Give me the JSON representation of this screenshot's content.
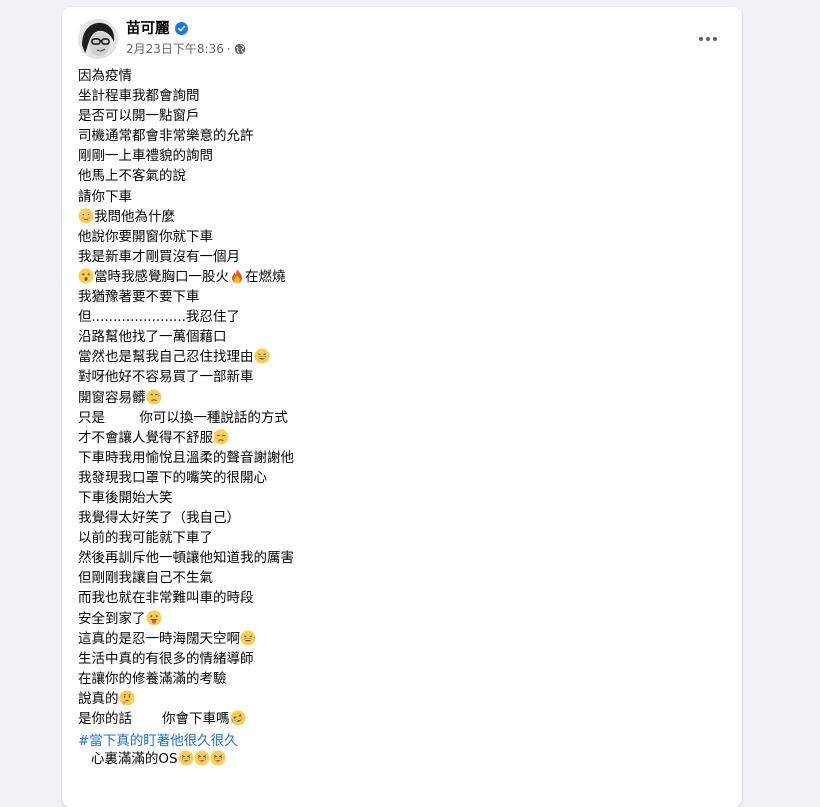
{
  "post": {
    "author": "苗可麗",
    "timestamp": "2月23日下午8:36",
    "meta_separator": "·",
    "lines": [
      {
        "text": "因為疫情"
      },
      {
        "text": "坐計程車我都會詢問"
      },
      {
        "text": "是否可以開一點窗戶"
      },
      {
        "text": "司機通常都會非常樂意的允許"
      },
      {
        "text": "剛剛一上車禮貌的詢問"
      },
      {
        "text": "他馬上不客氣的說"
      },
      {
        "text": "請你下車"
      },
      {
        "text": "我問他為什麼",
        "emoji_before": "flushed-face"
      },
      {
        "text": "他說你要開窗你就下車"
      },
      {
        "text": "我是新車才剛買沒有一個月"
      },
      {
        "text": "當時我感覺胸口一股火",
        "emoji_before": "astonished-face",
        "emoji_after": "fire",
        "text_after": "在燃燒"
      },
      {
        "text": "我猶豫著要不要下車"
      },
      {
        "text": "但......................我忍住了"
      },
      {
        "text": "沿路幫他找了一萬個藉口"
      },
      {
        "text": "當然也是幫我自己忍住找理由",
        "emoji_after": "grinning-face"
      },
      {
        "text": "對呀他好不容易買了一部新車"
      },
      {
        "text": "開窗容易髒",
        "emoji_after": "sad-sweat-face"
      },
      {
        "text": "只是        你可以換一種說話的方式"
      },
      {
        "text": "才不會讓人覺得不舒服",
        "emoji_after": "unamused-face"
      },
      {
        "text": "下車時我用愉悅且溫柔的聲音謝謝他"
      },
      {
        "text": "我發現我口罩下的嘴笑的很開心"
      },
      {
        "text": "下車後開始大笑"
      },
      {
        "text": "我覺得太好笑了（我自己）"
      },
      {
        "text": "以前的我可能就下車了"
      },
      {
        "text": "然後再訓斥他一頓讓他知道我的厲害"
      },
      {
        "text": "但剛剛我讓自己不生氣"
      },
      {
        "text": "而我也就在非常難叫車的時段"
      },
      {
        "text": "安全到家了",
        "emoji_after": "tongue-face"
      },
      {
        "text": "這真的是忍一時海闊天空啊",
        "emoji_after": "grinning-face"
      },
      {
        "text": "生活中真的有很多的情緒導師"
      },
      {
        "text": "在讓你的修養滿滿的考驗"
      },
      {
        "text": "說真的",
        "emoji_after": "thinking-face"
      },
      {
        "text": "是你的話       你會下車嗎",
        "emoji_after": "rofl-face"
      }
    ],
    "hashtag": "#當下真的盯著他很久很久",
    "final_line": {
      "text": "   心裏滿滿的OS",
      "emojis": [
        "grinning-squint-face",
        "grinning-squint-face",
        "grinning-squint-face"
      ]
    }
  }
}
